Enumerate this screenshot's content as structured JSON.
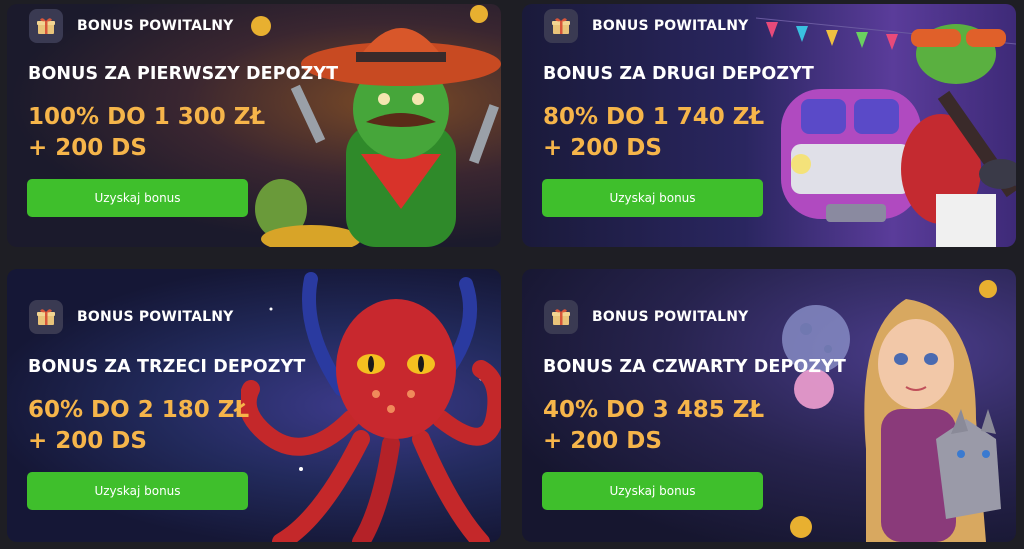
{
  "colors": {
    "page_bg": "#1e1e24",
    "amount_text": "#f6b54a",
    "button_bg": "#3fbf2c",
    "title_text": "#ffffff"
  },
  "cards": [
    {
      "badge_label": "BONUS POWITALNY",
      "badge_icon": "gift-icon",
      "title": "BONUS ZA PIERWSZY DEPOZYT",
      "amount_line1": "100% DO 1 300 ZŁ",
      "amount_line2": "+ 200 DS",
      "button_label": "Uzyskaj bonus",
      "art": "cowboy-cactus-illustration"
    },
    {
      "badge_label": "BONUS POWITALNY",
      "badge_icon": "gift-icon",
      "title": "BONUS ZA DRUGI DEPOZYT",
      "amount_line1": "80% DO 1 740 ZŁ",
      "amount_line2": "+ 200 DS",
      "button_label": "Uzyskaj bonus",
      "art": "frog-guitar-van-illustration"
    },
    {
      "badge_label": "BONUS POWITALNY",
      "badge_icon": "gift-icon",
      "title": "BONUS ZA TRZECI DEPOZYT",
      "amount_line1": "60% DO 2 180 ZŁ",
      "amount_line2": "+ 200 DS",
      "button_label": "Uzyskaj bonus",
      "art": "red-octopus-illustration"
    },
    {
      "badge_label": "BONUS POWITALNY",
      "badge_icon": "gift-icon",
      "title": "BONUS ZA CZWARTY DEPOZYT",
      "amount_line1": "40% DO 3 485 ZŁ",
      "amount_line2": "+ 200 DS",
      "button_label": "Uzyskaj bonus",
      "art": "princess-wolf-illustration"
    }
  ]
}
